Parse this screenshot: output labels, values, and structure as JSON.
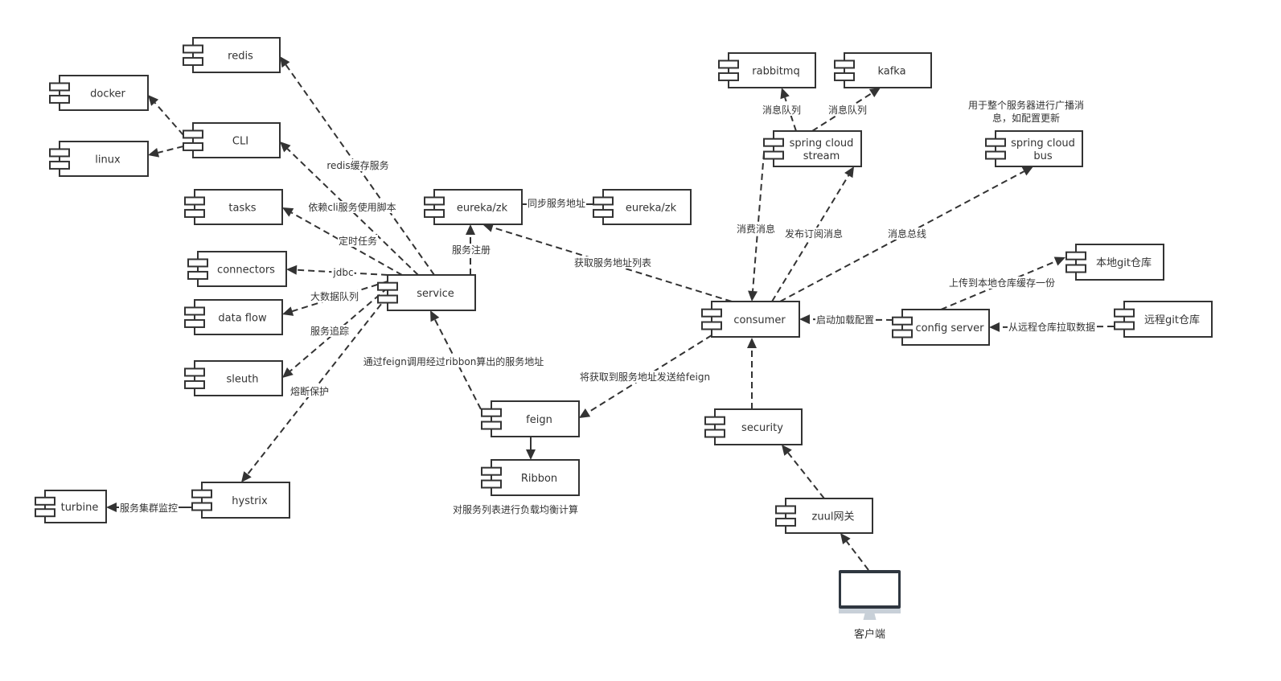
{
  "diagram": {
    "type": "component-diagram",
    "components": [
      {
        "id": "redis",
        "label": [
          "redis"
        ]
      },
      {
        "id": "docker",
        "label": [
          "docker"
        ]
      },
      {
        "id": "cli",
        "label": [
          "CLI"
        ]
      },
      {
        "id": "linux",
        "label": [
          "linux"
        ]
      },
      {
        "id": "tasks",
        "label": [
          "tasks"
        ]
      },
      {
        "id": "connectors",
        "label": [
          "connectors"
        ]
      },
      {
        "id": "dataflow",
        "label": [
          "data flow"
        ]
      },
      {
        "id": "sleuth",
        "label": [
          "sleuth"
        ]
      },
      {
        "id": "service",
        "label": [
          "service"
        ]
      },
      {
        "id": "eureka1",
        "label": [
          "eureka/zk"
        ]
      },
      {
        "id": "eureka2",
        "label": [
          "eureka/zk"
        ]
      },
      {
        "id": "hystrix",
        "label": [
          "hystrix"
        ]
      },
      {
        "id": "turbine",
        "label": [
          "turbine"
        ]
      },
      {
        "id": "feign",
        "label": [
          "feign"
        ]
      },
      {
        "id": "ribbon",
        "label": [
          "Ribbon"
        ]
      },
      {
        "id": "rabbitmq",
        "label": [
          "rabbitmq"
        ]
      },
      {
        "id": "kafka",
        "label": [
          "kafka"
        ]
      },
      {
        "id": "stream",
        "label": [
          "spring cloud",
          "stream"
        ]
      },
      {
        "id": "bus",
        "label": [
          "spring cloud",
          "bus"
        ]
      },
      {
        "id": "consumer",
        "label": [
          "consumer"
        ]
      },
      {
        "id": "configserver",
        "label": [
          "config server"
        ]
      },
      {
        "id": "localgit",
        "label": [
          "本地git仓库"
        ]
      },
      {
        "id": "remotegit",
        "label": [
          "远程git仓库"
        ]
      },
      {
        "id": "security",
        "label": [
          "security"
        ]
      },
      {
        "id": "zuul",
        "label": [
          "zuul网关"
        ]
      }
    ],
    "client": {
      "id": "client",
      "label": "客户端"
    },
    "edges": [
      {
        "from": "service",
        "to": "redis",
        "label": "redis缓存服务",
        "style": "dashed"
      },
      {
        "from": "service",
        "to": "cli",
        "label": "依赖cli服务使用脚本",
        "style": "dashed"
      },
      {
        "from": "cli",
        "to": "docker",
        "label": "",
        "style": "dashed"
      },
      {
        "from": "cli",
        "to": "linux",
        "label": "",
        "style": "dashed"
      },
      {
        "from": "service",
        "to": "tasks",
        "label": "定时任务",
        "style": "dashed"
      },
      {
        "from": "service",
        "to": "connectors",
        "label": "jdbc",
        "style": "dashed"
      },
      {
        "from": "service",
        "to": "dataflow",
        "label": "大数据队列",
        "style": "dashed"
      },
      {
        "from": "service",
        "to": "sleuth",
        "label": "服务追踪",
        "style": "dashed"
      },
      {
        "from": "service",
        "to": "hystrix",
        "label": "熔断保护",
        "style": "dashed"
      },
      {
        "from": "hystrix",
        "to": "turbine",
        "label": "服务集群监控",
        "style": "solid"
      },
      {
        "from": "service",
        "to": "eureka1",
        "label": "服务注册",
        "style": "dashed"
      },
      {
        "from": "eureka1",
        "to": "eureka2",
        "label": "同步服务地址",
        "style": "solid-noarrow"
      },
      {
        "from": "consumer",
        "to": "eureka1",
        "label": "获取服务地址列表",
        "style": "dashed"
      },
      {
        "from": "feign",
        "to": "service",
        "label": "通过feign调用经过ribbon算出的服务地址",
        "style": "dashed"
      },
      {
        "from": "consumer",
        "to": "feign",
        "label": "将获取到服务地址发送给feign",
        "style": "dashed"
      },
      {
        "from": "feign",
        "to": "ribbon",
        "label": "",
        "style": "solid"
      },
      {
        "from": "stream",
        "to": "rabbitmq",
        "label": "消息队列",
        "style": "dashed"
      },
      {
        "from": "stream",
        "to": "kafka",
        "label": "消息队列",
        "style": "dashed"
      },
      {
        "from": "stream",
        "to": "consumer",
        "label": "消费消息",
        "style": "dashed"
      },
      {
        "from": "consumer",
        "to": "stream",
        "label": "发布订阅消息",
        "style": "dashed"
      },
      {
        "from": "consumer",
        "to": "bus",
        "label": "消息总线",
        "style": "dashed"
      },
      {
        "from": "configserver",
        "to": "consumer",
        "label": "启动加载配置",
        "style": "dashed"
      },
      {
        "from": "configserver",
        "to": "localgit",
        "label": "上传到本地仓库缓存一份",
        "style": "dashed"
      },
      {
        "from": "remotegit",
        "to": "configserver",
        "label": "从远程仓库拉取数据",
        "style": "dashed"
      },
      {
        "from": "security",
        "to": "consumer",
        "label": "",
        "style": "dashed"
      },
      {
        "from": "zuul",
        "to": "security",
        "label": "",
        "style": "dashed"
      },
      {
        "from": "client",
        "to": "zuul",
        "label": "",
        "style": "dashed"
      }
    ],
    "notes": [
      {
        "id": "ribbon-note",
        "text": [
          "对服务列表进行负载均衡计算"
        ]
      },
      {
        "id": "bus-note",
        "text": [
          "用于整个服务器进行广播消",
          "息，如配置更新"
        ]
      }
    ],
    "colors": {
      "stroke": "#333333",
      "background": "#ffffff",
      "monitor_frame": "#2f3740",
      "monitor_stand": "#c8d0d8"
    }
  }
}
